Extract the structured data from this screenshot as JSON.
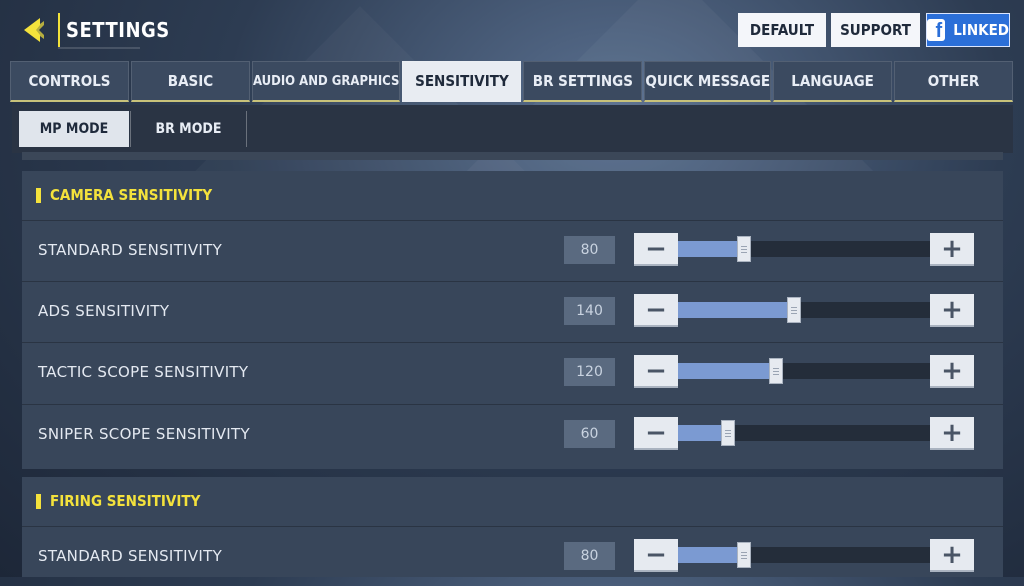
{
  "header": {
    "title": "SETTINGS",
    "buttons": {
      "default": "DEFAULT",
      "support": "SUPPORT",
      "linked": "LINKED"
    }
  },
  "tabs": [
    {
      "label": "CONTROLS"
    },
    {
      "label": "BASIC"
    },
    {
      "label": "AUDIO AND GRAPHICS"
    },
    {
      "label": "SENSITIVITY",
      "active": true
    },
    {
      "label": "BR SETTINGS"
    },
    {
      "label": "QUICK MESSAGE"
    },
    {
      "label": "LANGUAGE"
    },
    {
      "label": "OTHER"
    }
  ],
  "modes": {
    "mp": "MP MODE",
    "br": "BR MODE"
  },
  "camera": {
    "title": "CAMERA SENSITIVITY",
    "rows": [
      {
        "label": "STANDARD SENSITIVITY",
        "value": "80",
        "fraction": 0.26
      },
      {
        "label": "ADS SENSITIVITY",
        "value": "140",
        "fraction": 0.46
      },
      {
        "label": "TACTIC SCOPE SENSITIVITY",
        "value": "120",
        "fraction": 0.39
      },
      {
        "label": "SNIPER SCOPE SENSITIVITY",
        "value": "60",
        "fraction": 0.2
      }
    ]
  },
  "firing": {
    "title": "FIRING SENSITIVITY",
    "rows": [
      {
        "label": "STANDARD SENSITIVITY",
        "value": "80",
        "fraction": 0.26
      }
    ]
  },
  "icons": {
    "back": "back-arrow-icon",
    "facebook": "facebook-icon",
    "minus": "−",
    "plus": "+"
  },
  "colors": {
    "accent": "#f4e23c",
    "fill": "#7b9ad2",
    "facebook": "#2b6fd8"
  }
}
